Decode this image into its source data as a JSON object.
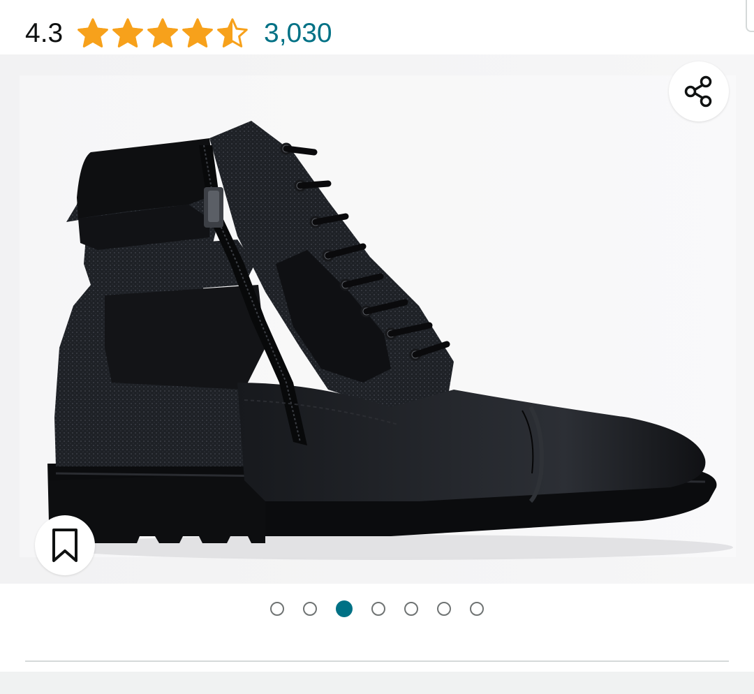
{
  "rating": {
    "value": "4.3",
    "stars": 4.5,
    "count": "3,030",
    "star_color": "#f7a11b",
    "link_color": "#007185"
  },
  "gallery": {
    "total_images": 7,
    "active_index": 2,
    "accent": "#007185"
  },
  "icons": {
    "share": "share-icon",
    "save": "bookmark-icon"
  }
}
